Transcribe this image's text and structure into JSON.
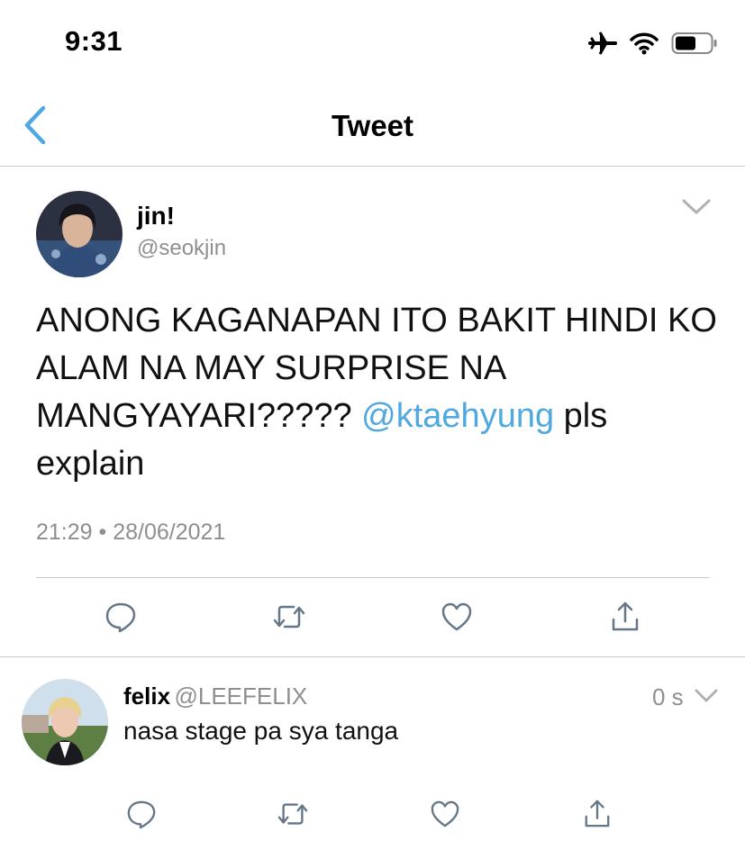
{
  "status_bar": {
    "time": "9:31"
  },
  "nav": {
    "title": "Tweet"
  },
  "tweet": {
    "author_name": "jin!",
    "author_handle": "@seokjin",
    "text_part1": "ANONG KAGANAPAN ITO BAKIT HINDI KO ALAM NA MAY SURPRISE NA MANGYAYARI?????",
    "mention": "@ktaehyung",
    "text_part2": "pls explain",
    "timestamp": "21:29 • 28/06/2021"
  },
  "reply": {
    "author_name": "felix",
    "author_handle": "@LEEFELIX",
    "time": "0 s",
    "text": "nasa stage pa sya tanga"
  },
  "colors": {
    "accent": "#4fa8e0",
    "secondary_text": "#8e8e93",
    "divider": "#c8c8cc",
    "icon": "#657786"
  }
}
